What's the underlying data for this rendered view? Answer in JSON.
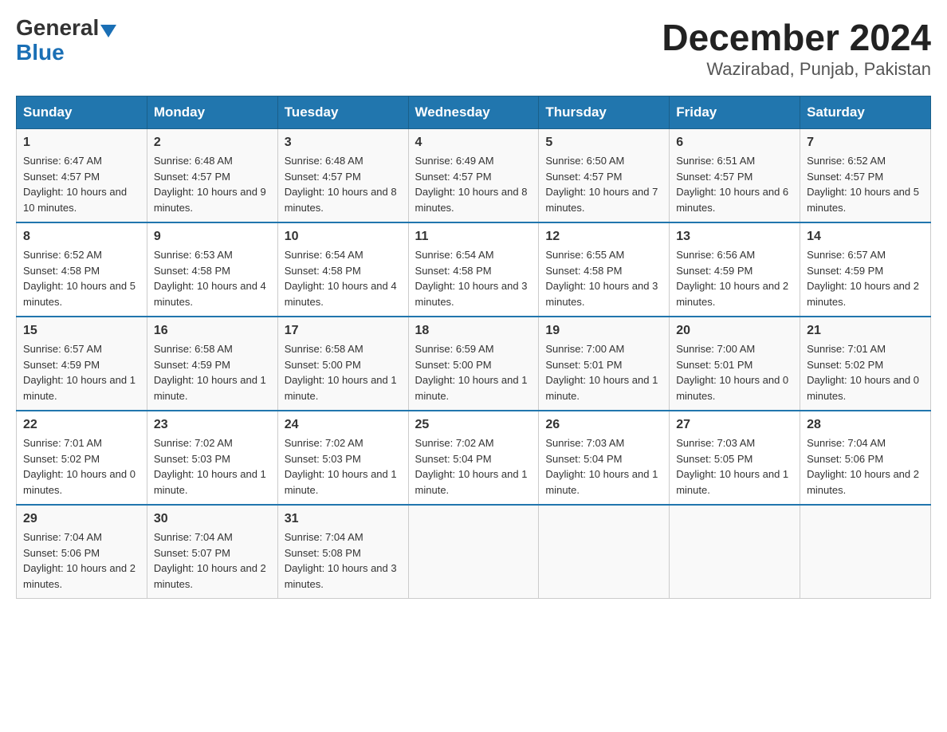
{
  "logo": {
    "general": "General",
    "blue": "Blue"
  },
  "title": "December 2024",
  "location": "Wazirabad, Punjab, Pakistan",
  "days_of_week": [
    "Sunday",
    "Monday",
    "Tuesday",
    "Wednesday",
    "Thursday",
    "Friday",
    "Saturday"
  ],
  "weeks": [
    [
      {
        "day": "1",
        "sunrise": "6:47 AM",
        "sunset": "4:57 PM",
        "daylight": "10 hours and 10 minutes."
      },
      {
        "day": "2",
        "sunrise": "6:48 AM",
        "sunset": "4:57 PM",
        "daylight": "10 hours and 9 minutes."
      },
      {
        "day": "3",
        "sunrise": "6:48 AM",
        "sunset": "4:57 PM",
        "daylight": "10 hours and 8 minutes."
      },
      {
        "day": "4",
        "sunrise": "6:49 AM",
        "sunset": "4:57 PM",
        "daylight": "10 hours and 8 minutes."
      },
      {
        "day": "5",
        "sunrise": "6:50 AM",
        "sunset": "4:57 PM",
        "daylight": "10 hours and 7 minutes."
      },
      {
        "day": "6",
        "sunrise": "6:51 AM",
        "sunset": "4:57 PM",
        "daylight": "10 hours and 6 minutes."
      },
      {
        "day": "7",
        "sunrise": "6:52 AM",
        "sunset": "4:57 PM",
        "daylight": "10 hours and 5 minutes."
      }
    ],
    [
      {
        "day": "8",
        "sunrise": "6:52 AM",
        "sunset": "4:58 PM",
        "daylight": "10 hours and 5 minutes."
      },
      {
        "day": "9",
        "sunrise": "6:53 AM",
        "sunset": "4:58 PM",
        "daylight": "10 hours and 4 minutes."
      },
      {
        "day": "10",
        "sunrise": "6:54 AM",
        "sunset": "4:58 PM",
        "daylight": "10 hours and 4 minutes."
      },
      {
        "day": "11",
        "sunrise": "6:54 AM",
        "sunset": "4:58 PM",
        "daylight": "10 hours and 3 minutes."
      },
      {
        "day": "12",
        "sunrise": "6:55 AM",
        "sunset": "4:58 PM",
        "daylight": "10 hours and 3 minutes."
      },
      {
        "day": "13",
        "sunrise": "6:56 AM",
        "sunset": "4:59 PM",
        "daylight": "10 hours and 2 minutes."
      },
      {
        "day": "14",
        "sunrise": "6:57 AM",
        "sunset": "4:59 PM",
        "daylight": "10 hours and 2 minutes."
      }
    ],
    [
      {
        "day": "15",
        "sunrise": "6:57 AM",
        "sunset": "4:59 PM",
        "daylight": "10 hours and 1 minute."
      },
      {
        "day": "16",
        "sunrise": "6:58 AM",
        "sunset": "4:59 PM",
        "daylight": "10 hours and 1 minute."
      },
      {
        "day": "17",
        "sunrise": "6:58 AM",
        "sunset": "5:00 PM",
        "daylight": "10 hours and 1 minute."
      },
      {
        "day": "18",
        "sunrise": "6:59 AM",
        "sunset": "5:00 PM",
        "daylight": "10 hours and 1 minute."
      },
      {
        "day": "19",
        "sunrise": "7:00 AM",
        "sunset": "5:01 PM",
        "daylight": "10 hours and 1 minute."
      },
      {
        "day": "20",
        "sunrise": "7:00 AM",
        "sunset": "5:01 PM",
        "daylight": "10 hours and 0 minutes."
      },
      {
        "day": "21",
        "sunrise": "7:01 AM",
        "sunset": "5:02 PM",
        "daylight": "10 hours and 0 minutes."
      }
    ],
    [
      {
        "day": "22",
        "sunrise": "7:01 AM",
        "sunset": "5:02 PM",
        "daylight": "10 hours and 0 minutes."
      },
      {
        "day": "23",
        "sunrise": "7:02 AM",
        "sunset": "5:03 PM",
        "daylight": "10 hours and 1 minute."
      },
      {
        "day": "24",
        "sunrise": "7:02 AM",
        "sunset": "5:03 PM",
        "daylight": "10 hours and 1 minute."
      },
      {
        "day": "25",
        "sunrise": "7:02 AM",
        "sunset": "5:04 PM",
        "daylight": "10 hours and 1 minute."
      },
      {
        "day": "26",
        "sunrise": "7:03 AM",
        "sunset": "5:04 PM",
        "daylight": "10 hours and 1 minute."
      },
      {
        "day": "27",
        "sunrise": "7:03 AM",
        "sunset": "5:05 PM",
        "daylight": "10 hours and 1 minute."
      },
      {
        "day": "28",
        "sunrise": "7:04 AM",
        "sunset": "5:06 PM",
        "daylight": "10 hours and 2 minutes."
      }
    ],
    [
      {
        "day": "29",
        "sunrise": "7:04 AM",
        "sunset": "5:06 PM",
        "daylight": "10 hours and 2 minutes."
      },
      {
        "day": "30",
        "sunrise": "7:04 AM",
        "sunset": "5:07 PM",
        "daylight": "10 hours and 2 minutes."
      },
      {
        "day": "31",
        "sunrise": "7:04 AM",
        "sunset": "5:08 PM",
        "daylight": "10 hours and 3 minutes."
      },
      null,
      null,
      null,
      null
    ]
  ],
  "labels": {
    "sunrise_prefix": "Sunrise: ",
    "sunset_prefix": "Sunset: ",
    "daylight_prefix": "Daylight: "
  }
}
